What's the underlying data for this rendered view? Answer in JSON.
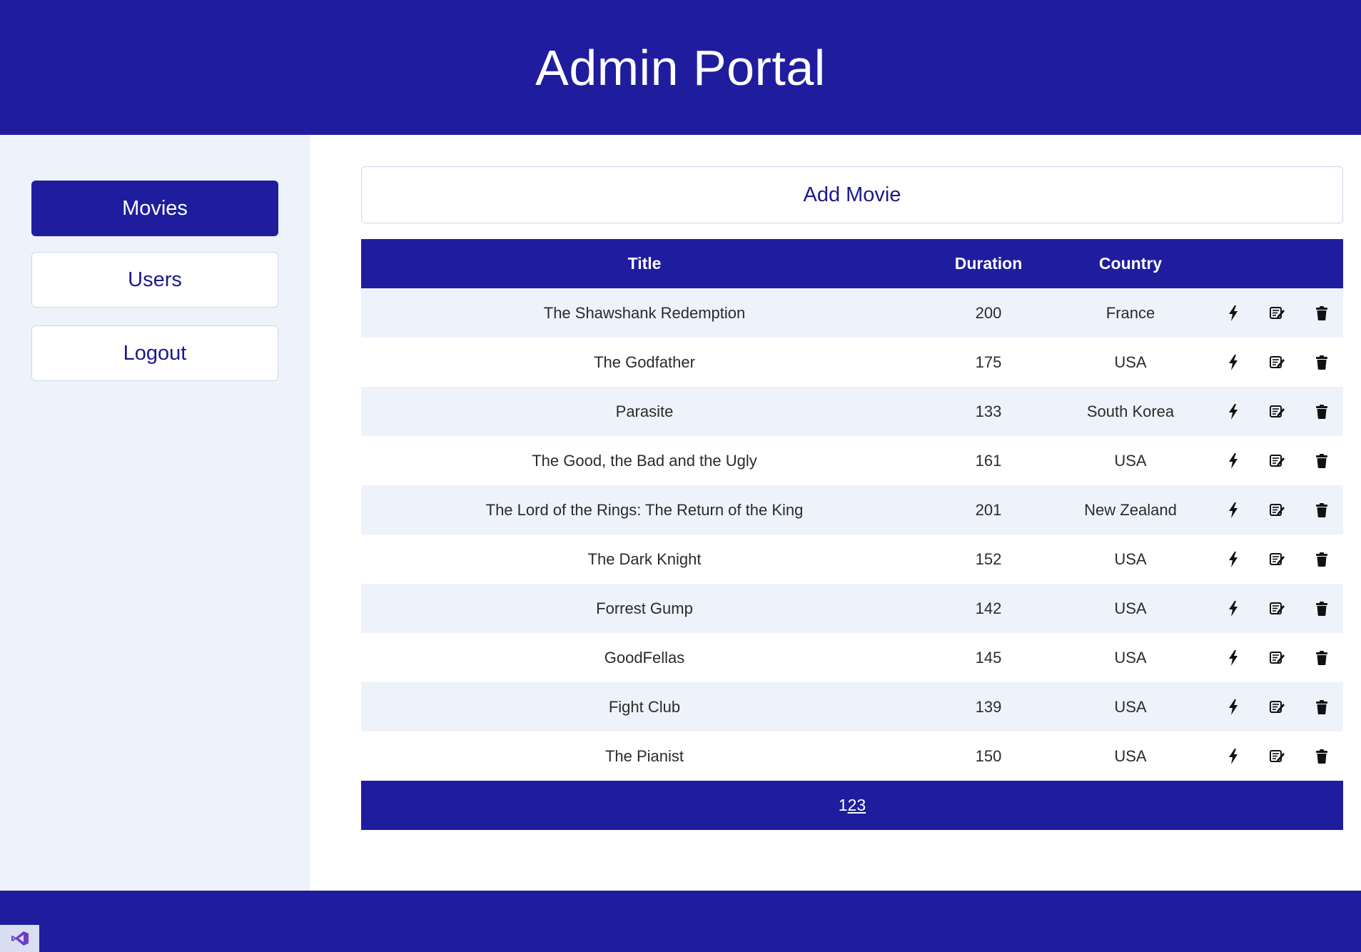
{
  "header": {
    "title": "Admin Portal"
  },
  "sidebar": {
    "items": [
      {
        "label": "Movies",
        "active": true
      },
      {
        "label": "Users",
        "active": false
      },
      {
        "label": "Logout",
        "active": false
      }
    ]
  },
  "main": {
    "add_button_label": "Add Movie",
    "table": {
      "columns": [
        "Title",
        "Duration",
        "Country"
      ],
      "rows": [
        {
          "title": "The Shawshank Redemption",
          "duration": "200",
          "country": "France"
        },
        {
          "title": "The Godfather",
          "duration": "175",
          "country": "USA"
        },
        {
          "title": "Parasite",
          "duration": "133",
          "country": "South Korea"
        },
        {
          "title": "The Good, the Bad and the Ugly",
          "duration": "161",
          "country": "USA"
        },
        {
          "title": "The Lord of the Rings: The Return of the King",
          "duration": "201",
          "country": "New Zealand"
        },
        {
          "title": "The Dark Knight",
          "duration": "152",
          "country": "USA"
        },
        {
          "title": "Forrest Gump",
          "duration": "142",
          "country": "USA"
        },
        {
          "title": "GoodFellas",
          "duration": "145",
          "country": "USA"
        },
        {
          "title": "Fight Club",
          "duration": "139",
          "country": "USA"
        },
        {
          "title": "The Pianist",
          "duration": "150",
          "country": "USA"
        }
      ],
      "row_actions": [
        "lightning-icon",
        "edit-icon",
        "trash-icon"
      ]
    },
    "pagination": {
      "pages": [
        "1",
        "2",
        "3"
      ],
      "current": "1"
    }
  },
  "colors": {
    "primary": "#1f1d9e",
    "sidebar_bg": "#eef2fb",
    "row_alt_bg": "#eef2fb",
    "link_text": "#1b1a8a"
  },
  "footer": {
    "badge_icon": "visual-studio-icon"
  }
}
